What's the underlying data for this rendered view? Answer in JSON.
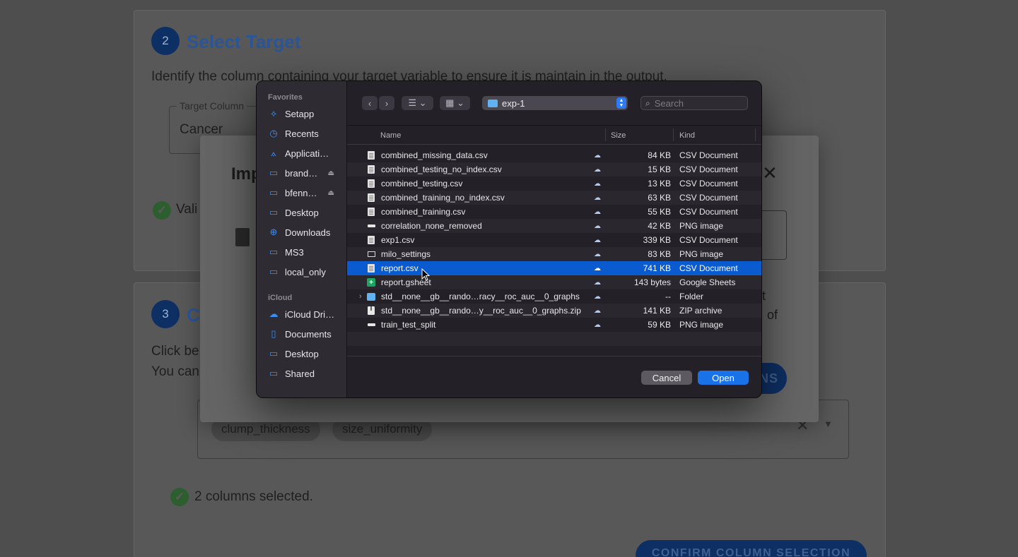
{
  "background": {
    "step2": {
      "number": "2",
      "title": "Select Target",
      "description": "Identify the column containing your target variable to ensure it is maintain in the output.",
      "target_legend": "Target Column",
      "target_value": "Cancer"
    },
    "step3": {
      "number": "3",
      "title_partial": "C",
      "desc_line1": "Click be",
      "desc_line2": "You can",
      "chips": [
        "clump_thickness",
        "size_uniformity"
      ],
      "status": "2 columns selected.",
      "confirm_button": "CONFIRM COLUMN SELECTION"
    }
  },
  "modal": {
    "title_partial": "Imp",
    "validation_partial": "Vali",
    "right_text1": "t",
    "right_text2": "of",
    "button_partial": "NS"
  },
  "dialog": {
    "sidebar": {
      "favorites_label": "Favorites",
      "favorites": [
        {
          "label": "Setapp",
          "icon": "setapp-icon"
        },
        {
          "label": "Recents",
          "icon": "clock-icon"
        },
        {
          "label": "Applicati…",
          "icon": "applications-icon"
        },
        {
          "label": "brand…",
          "icon": "network-folder-icon",
          "eject": true
        },
        {
          "label": "bfenn…",
          "icon": "network-folder-icon",
          "eject": true
        },
        {
          "label": "Desktop",
          "icon": "desktop-icon"
        },
        {
          "label": "Downloads",
          "icon": "downloads-icon"
        },
        {
          "label": "MS3",
          "icon": "folder-icon"
        },
        {
          "label": "local_only",
          "icon": "folder-icon"
        }
      ],
      "icloud_label": "iCloud",
      "icloud": [
        {
          "label": "iCloud Dri…",
          "icon": "icloud-icon"
        },
        {
          "label": "Documents",
          "icon": "document-icon"
        },
        {
          "label": "Desktop",
          "icon": "desktop-icon"
        },
        {
          "label": "Shared",
          "icon": "shared-folder-icon"
        }
      ]
    },
    "toolbar": {
      "current_folder": "exp-1",
      "search_placeholder": "Search"
    },
    "columns": {
      "name": "Name",
      "size": "Size",
      "kind": "Kind"
    },
    "files": [
      {
        "name": "combined_missing_data.csv",
        "size": "84 KB",
        "kind": "CSV Document",
        "icon": "doc"
      },
      {
        "name": "combined_testing_no_index.csv",
        "size": "15 KB",
        "kind": "CSV Document",
        "icon": "doc"
      },
      {
        "name": "combined_testing.csv",
        "size": "13 KB",
        "kind": "CSV Document",
        "icon": "doc"
      },
      {
        "name": "combined_training_no_index.csv",
        "size": "63 KB",
        "kind": "CSV Document",
        "icon": "doc"
      },
      {
        "name": "combined_training.csv",
        "size": "55 KB",
        "kind": "CSV Document",
        "icon": "doc"
      },
      {
        "name": "correlation_none_removed",
        "size": "42 KB",
        "kind": "PNG image",
        "icon": "png"
      },
      {
        "name": "exp1.csv",
        "size": "339 KB",
        "kind": "CSV Document",
        "icon": "doc"
      },
      {
        "name": "milo_settings",
        "size": "83 KB",
        "kind": "PNG image",
        "icon": "png-hollow"
      },
      {
        "name": "report.csv",
        "size": "741 KB",
        "kind": "CSV Document",
        "icon": "doc",
        "selected": true
      },
      {
        "name": "report.gsheet",
        "size": "143 bytes",
        "kind": "Google Sheets",
        "icon": "sheet"
      },
      {
        "name": "std__none__gb__rando…racy__roc_auc__0_graphs",
        "size": "--",
        "kind": "Folder",
        "icon": "folder",
        "disclosure": true
      },
      {
        "name": "std__none__gb__rando…y__roc_auc__0_graphs.zip",
        "size": "141 KB",
        "kind": "ZIP archive",
        "icon": "zip"
      },
      {
        "name": "train_test_split",
        "size": "59 KB",
        "kind": "PNG image",
        "icon": "png"
      }
    ],
    "buttons": {
      "cancel": "Cancel",
      "open": "Open"
    }
  }
}
